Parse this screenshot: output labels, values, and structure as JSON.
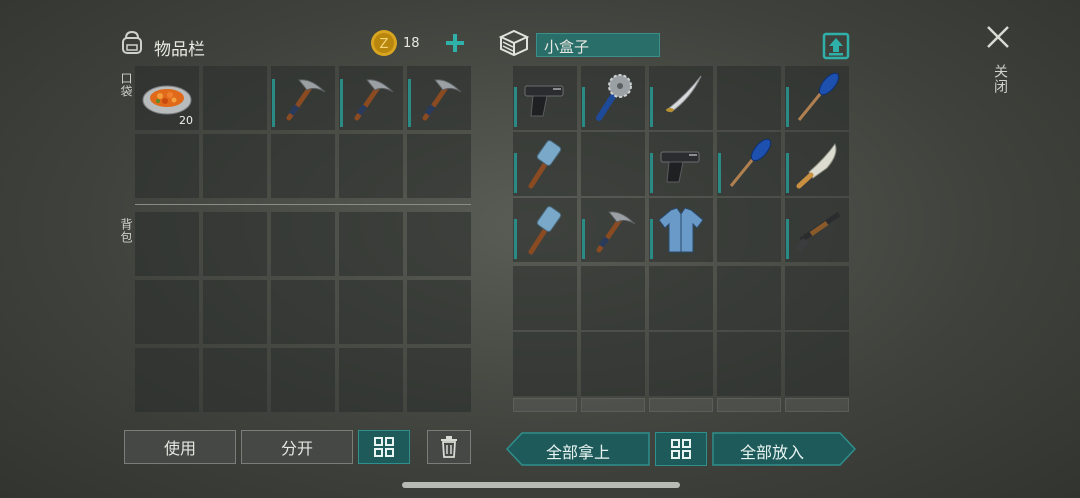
{
  "inventory": {
    "title": "物品栏",
    "coin_count": "18",
    "pocket_label": "口袋",
    "backpack_label": "背包",
    "pocket_items": [
      {
        "icon": "stew-plate-icon",
        "qty": "20"
      },
      {
        "icon": "empty"
      },
      {
        "icon": "pickaxe-icon"
      },
      {
        "icon": "pickaxe-icon"
      },
      {
        "icon": "pickaxe-icon"
      }
    ]
  },
  "container": {
    "name": "小盒子",
    "items": [
      {
        "icon": "pistol-icon"
      },
      {
        "icon": "saw-club-icon"
      },
      {
        "icon": "katana-icon"
      },
      {
        "icon": "empty"
      },
      {
        "icon": "paddle-icon"
      },
      {
        "icon": "sledgehammer-icon"
      },
      {
        "icon": "empty"
      },
      {
        "icon": "pistol-icon"
      },
      {
        "icon": "paddle-icon"
      },
      {
        "icon": "machete-icon"
      },
      {
        "icon": "sledgehammer-icon"
      },
      {
        "icon": "pickaxe-icon"
      },
      {
        "icon": "shirt-icon"
      },
      {
        "icon": "empty"
      },
      {
        "icon": "shotgun-icon"
      }
    ]
  },
  "actions": {
    "use": "使用",
    "split": "分开",
    "take_all": "全部拿上",
    "put_all": "全部放入"
  },
  "close_label": "关闭",
  "colors": {
    "accent": "#2f8f8c",
    "panel_dark": "#282c2a",
    "coin": "#d9a520"
  }
}
